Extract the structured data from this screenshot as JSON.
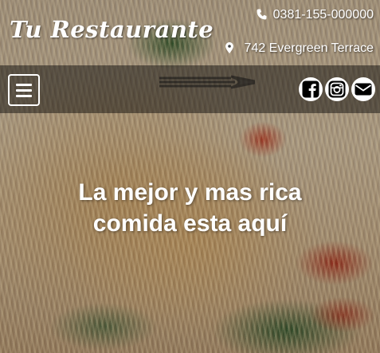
{
  "header": {
    "brand": "Tu Restaurante",
    "phone": "0381-155-000000",
    "address": "742 Evergreen Terrace"
  },
  "nav": {
    "menu_icon": "hamburger-menu-icon",
    "socials": [
      {
        "icon": "facebook-icon"
      },
      {
        "icon": "instagram-icon"
      },
      {
        "icon": "envelope-icon"
      }
    ]
  },
  "hero": {
    "headline_line1": "La mejor y mas rica",
    "headline_line2": "comida esta aquí"
  },
  "colors": {
    "text": "#ffffff",
    "navbar_overlay": "rgba(0,0,0,0.45)"
  }
}
